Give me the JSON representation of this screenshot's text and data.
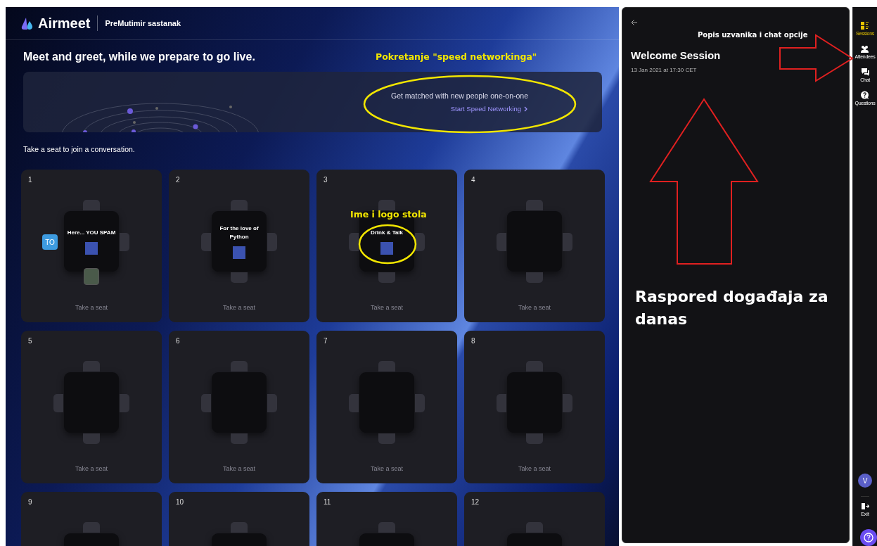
{
  "header": {
    "brand": "Airmeet",
    "event": "PreMutimir sastanak"
  },
  "headline": "Meet and greet, while we prepare to go live.",
  "speed_networking": {
    "text": "Get matched with new people one-on-one",
    "link": "Start Speed Networking"
  },
  "prompt": "Take a seat to join a conversation.",
  "tables": [
    {
      "number": "1",
      "name": "Here... YOU SPAM",
      "logo": true,
      "seat_label": "Take a seat",
      "seats": [
        {
          "occupied": false
        },
        {
          "occupied": false
        },
        {
          "occupied": true,
          "kind": "photo"
        },
        {
          "occupied": true,
          "kind": "initials",
          "text": "TO"
        }
      ]
    },
    {
      "number": "2",
      "name": "For the love of Python",
      "logo": true,
      "seat_label": "Take a seat"
    },
    {
      "number": "3",
      "name": "Drink & Talk",
      "logo": true,
      "seat_label": "Take a seat"
    },
    {
      "number": "4",
      "seat_label": "Take a seat"
    },
    {
      "number": "5",
      "seat_label": "Take a seat"
    },
    {
      "number": "6",
      "seat_label": "Take a seat"
    },
    {
      "number": "7",
      "seat_label": "Take a seat"
    },
    {
      "number": "8",
      "seat_label": "Take a seat"
    },
    {
      "number": "9"
    },
    {
      "number": "10"
    },
    {
      "number": "11"
    },
    {
      "number": "12"
    }
  ],
  "panel": {
    "title": "Welcome Session",
    "date": "13 Jan 2021 at 17:30 CET"
  },
  "rail": {
    "items": [
      {
        "kind": "sessions",
        "label": "Sessions",
        "selected": true
      },
      {
        "kind": "attendees",
        "label": "Attendees",
        "selected": false
      },
      {
        "kind": "chat",
        "label": "Chat",
        "selected": false
      },
      {
        "kind": "questions",
        "label": "Questions",
        "selected": false
      }
    ],
    "avatar": "V",
    "exit": "Exit"
  },
  "annotations": [
    {
      "kind": "yellow",
      "text": "Pokretanje \"speed networkinga\""
    },
    {
      "kind": "yellow",
      "text": "Ime i logo stola"
    },
    {
      "kind": "white",
      "text": "Popis uzvanika i chat opcije"
    },
    {
      "kind": "big",
      "text": "Raspored događaja za danas"
    }
  ]
}
